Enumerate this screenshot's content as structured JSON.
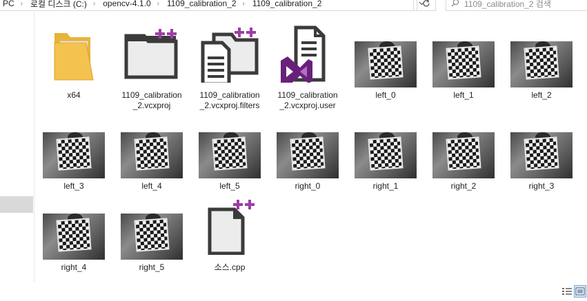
{
  "address": {
    "crumbs": [
      "PC",
      "로컬 디스크 (C:)",
      "opencv-4.1.0",
      "1109_calibration_2",
      "1109_calibration_2"
    ],
    "separator": "›",
    "dropdown_icon": "chevron-down-icon",
    "refresh_icon": "refresh-icon"
  },
  "search": {
    "placeholder": "1109_calibration_2 검색",
    "icon": "search-icon"
  },
  "files": [
    {
      "name": "x64",
      "kind": "folder"
    },
    {
      "name": "1109_calibration_2.vcxproj",
      "kind": "vcxproj",
      "label_lines": [
        "1109_calibration",
        "_2.vcxproj"
      ]
    },
    {
      "name": "1109_calibration_2.vcxproj.filters",
      "kind": "filters",
      "label_lines": [
        "1109_calibration",
        "_2.vcxproj.filters"
      ]
    },
    {
      "name": "1109_calibration_2.vcxproj.user",
      "kind": "user",
      "label_lines": [
        "1109_calibration",
        "_2.vcxproj.user"
      ]
    },
    {
      "name": "left_0",
      "kind": "image"
    },
    {
      "name": "left_1",
      "kind": "image"
    },
    {
      "name": "left_2",
      "kind": "image"
    },
    {
      "name": "left_3",
      "kind": "image"
    },
    {
      "name": "left_4",
      "kind": "image"
    },
    {
      "name": "left_5",
      "kind": "image"
    },
    {
      "name": "right_0",
      "kind": "image"
    },
    {
      "name": "right_1",
      "kind": "image"
    },
    {
      "name": "right_2",
      "kind": "image"
    },
    {
      "name": "right_3",
      "kind": "image"
    },
    {
      "name": "right_4",
      "kind": "image"
    },
    {
      "name": "right_5",
      "kind": "image"
    },
    {
      "name": "소스.cpp",
      "kind": "cpp"
    }
  ],
  "colors": {
    "folder": "#f4c24e",
    "plus": "#9b3ea5",
    "vs_purple": "#68217a",
    "selection": "#d9d9d9"
  },
  "view": {
    "details_icon": "details-view-icon",
    "large_icons_icon": "large-icons-view-icon"
  }
}
